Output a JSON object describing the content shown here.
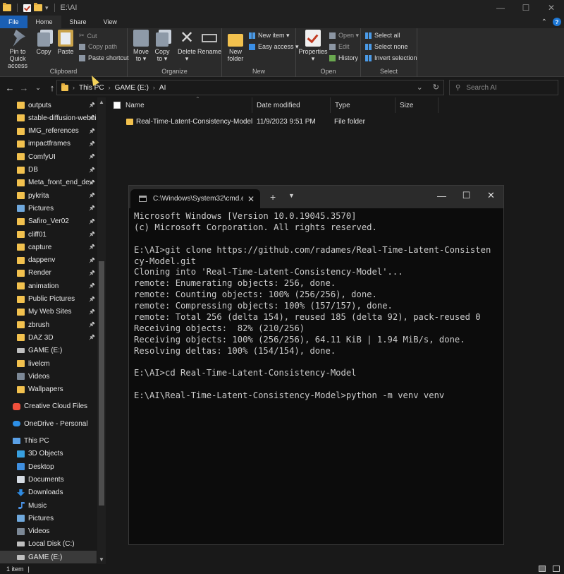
{
  "window": {
    "path": "E:\\AI",
    "minimize": "—",
    "maximize": "☐",
    "close": "✕"
  },
  "ribbon_tabs": [
    "File",
    "Home",
    "Share",
    "View"
  ],
  "ribbon": {
    "clipboard": {
      "label": "Clipboard",
      "pin_line1": "Pin to Quick",
      "pin_line2": "access",
      "copy": "Copy",
      "paste": "Paste",
      "cut": "Cut",
      "copy_path": "Copy path",
      "paste_shortcut": "Paste shortcut"
    },
    "organize": {
      "label": "Organize",
      "move_to_1": "Move",
      "move_to_2": "to ▾",
      "copy_to_1": "Copy",
      "copy_to_2": "to ▾",
      "delete_1": "Delete",
      "delete_2": "▾",
      "rename": "Rename"
    },
    "new": {
      "label": "New",
      "new_folder_1": "New",
      "new_folder_2": "folder",
      "new_item": "New item ▾",
      "easy_access": "Easy access ▾"
    },
    "open": {
      "label": "Open",
      "properties_1": "Properties",
      "properties_2": "▾",
      "open": "Open ▾",
      "edit": "Edit",
      "history": "History"
    },
    "select": {
      "label": "Select",
      "select_all": "Select all",
      "select_none": "Select none",
      "invert_selection": "Invert selection"
    }
  },
  "address": {
    "back": "←",
    "forward": "→",
    "recent": "⌄",
    "up": "↑",
    "crumbs": [
      "This PC",
      "GAME (E:)",
      "AI"
    ],
    "search_placeholder": "Search AI"
  },
  "nav_pane": {
    "items": [
      {
        "label": "outputs",
        "icon": "folder",
        "pinned": true
      },
      {
        "label": "stable-diffusion-webui",
        "icon": "folder",
        "pinned": true
      },
      {
        "label": "IMG_references",
        "icon": "folder",
        "pinned": true
      },
      {
        "label": "impactframes",
        "icon": "folder",
        "pinned": true
      },
      {
        "label": "ComfyUI",
        "icon": "folder",
        "pinned": true
      },
      {
        "label": "DB",
        "icon": "folder",
        "pinned": true
      },
      {
        "label": "Meta_front_end_dev",
        "icon": "folder",
        "pinned": true
      },
      {
        "label": "pykrita",
        "icon": "folder",
        "pinned": true
      },
      {
        "label": "Pictures",
        "icon": "pics",
        "pinned": true
      },
      {
        "label": "Safiro_Ver02",
        "icon": "folder",
        "pinned": true
      },
      {
        "label": "cliff01",
        "icon": "folder",
        "pinned": true
      },
      {
        "label": "capture",
        "icon": "folder",
        "pinned": true
      },
      {
        "label": "dappenv",
        "icon": "folder",
        "pinned": true
      },
      {
        "label": "Render",
        "icon": "folder",
        "pinned": true
      },
      {
        "label": "animation",
        "icon": "folder",
        "pinned": true
      },
      {
        "label": "Public Pictures",
        "icon": "folder",
        "pinned": true
      },
      {
        "label": "My Web Sites",
        "icon": "folder",
        "pinned": true
      },
      {
        "label": "zbrush",
        "icon": "folder",
        "pinned": true
      },
      {
        "label": "DAZ 3D",
        "icon": "folder",
        "pinned": true
      },
      {
        "label": "GAME (E:)",
        "icon": "drive",
        "pinned": false
      },
      {
        "label": "livelcm",
        "icon": "folder",
        "pinned": false
      },
      {
        "label": "Videos",
        "icon": "video",
        "pinned": false
      },
      {
        "label": "Wallpapers",
        "icon": "folder",
        "pinned": false
      },
      {
        "label": "Creative Cloud Files",
        "icon": "cloud",
        "pinned": false
      },
      {
        "label": "OneDrive - Personal",
        "icon": "onedrive",
        "pinned": false
      },
      {
        "label": "This PC",
        "icon": "pc",
        "pinned": false
      },
      {
        "label": "3D Objects",
        "icon": "obj",
        "pinned": false
      },
      {
        "label": "Desktop",
        "icon": "desk",
        "pinned": false
      },
      {
        "label": "Documents",
        "icon": "docs",
        "pinned": false
      },
      {
        "label": "Downloads",
        "icon": "down",
        "pinned": false
      },
      {
        "label": "Music",
        "icon": "music",
        "pinned": false
      },
      {
        "label": "Pictures",
        "icon": "pics",
        "pinned": false
      },
      {
        "label": "Videos",
        "icon": "video",
        "pinned": false
      },
      {
        "label": "Local Disk (C:)",
        "icon": "drive",
        "pinned": false
      },
      {
        "label": "GAME (E:)",
        "icon": "drive",
        "pinned": false,
        "selected": true
      }
    ]
  },
  "file_list": {
    "columns": [
      "Name",
      "Date modified",
      "Type",
      "Size"
    ],
    "rows": [
      {
        "name": "Real-Time-Latent-Consistency-Model",
        "date": "11/9/2023 9:51 PM",
        "type": "File folder",
        "size": ""
      }
    ]
  },
  "status": {
    "count": "1 item",
    "sep": "|"
  },
  "terminal": {
    "tab_title": "C:\\Windows\\System32\\cmd.exe",
    "lines": [
      "Microsoft Windows [Version 10.0.19045.3570]",
      "(c) Microsoft Corporation. All rights reserved.",
      "",
      "E:\\AI>git clone https://github.com/radames/Real-Time-Latent-Consisten",
      "cy-Model.git",
      "Cloning into 'Real-Time-Latent-Consistency-Model'...",
      "remote: Enumerating objects: 256, done.",
      "remote: Counting objects: 100% (256/256), done.",
      "remote: Compressing objects: 100% (157/157), done.",
      "remote: Total 256 (delta 154), reused 185 (delta 92), pack-reused 0",
      "Receiving objects:  82% (210/256)",
      "Receiving objects: 100% (256/256), 64.11 KiB | 1.94 MiB/s, done.",
      "Resolving deltas: 100% (154/154), done.",
      "",
      "E:\\AI>cd Real-Time-Latent-Consistency-Model",
      "",
      "E:\\AI\\Real-Time-Latent-Consistency-Model>python -m venv venv"
    ]
  }
}
